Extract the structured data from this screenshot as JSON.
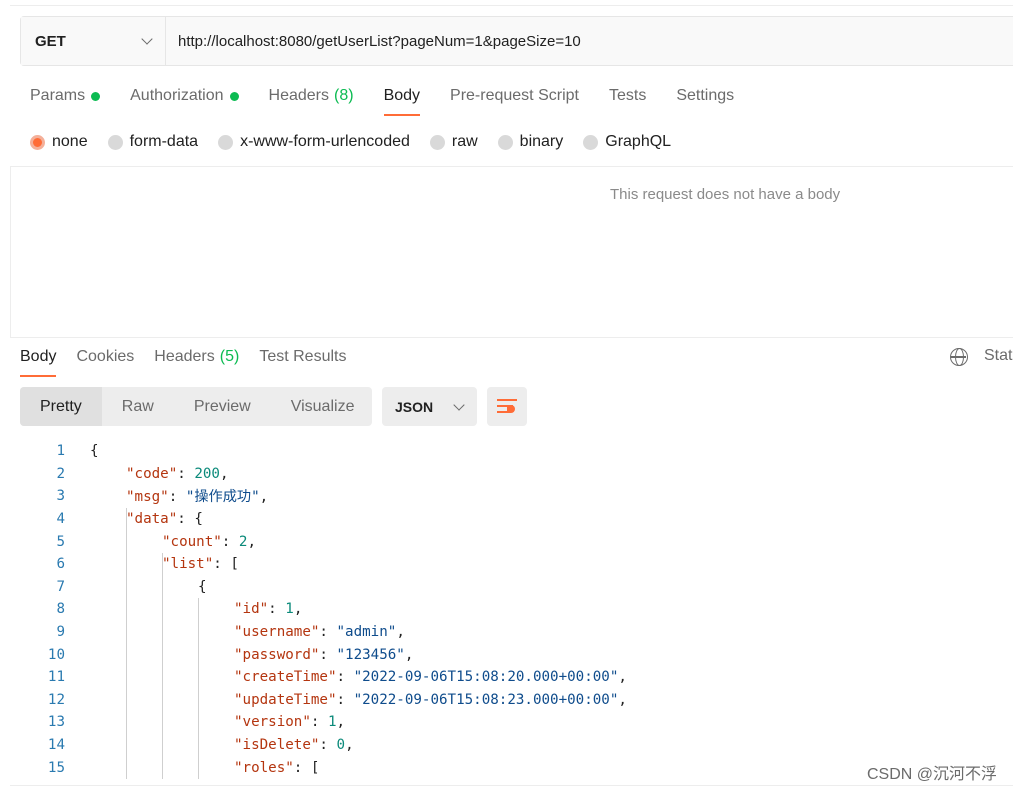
{
  "request": {
    "method": "GET",
    "url": "http://localhost:8080/getUserList?pageNum=1&pageSize=10"
  },
  "request_tabs": [
    {
      "label": "Params"
    },
    {
      "label": "Authorization"
    },
    {
      "label": "Headers",
      "count": "(8)"
    },
    {
      "label": "Body"
    },
    {
      "label": "Pre-request Script"
    },
    {
      "label": "Tests"
    },
    {
      "label": "Settings"
    }
  ],
  "body_types": [
    "none",
    "form-data",
    "x-www-form-urlencoded",
    "raw",
    "binary",
    "GraphQL"
  ],
  "no_body_message": "This request does not have a body",
  "response_tabs": [
    {
      "label": "Body"
    },
    {
      "label": "Cookies"
    },
    {
      "label": "Headers",
      "count": "(5)"
    },
    {
      "label": "Test Results"
    }
  ],
  "status_label": "Status",
  "view_modes": [
    "Pretty",
    "Raw",
    "Preview",
    "Visualize"
  ],
  "format": "JSON",
  "code_lines": [
    {
      "n": "1",
      "text": "{"
    },
    {
      "n": "2",
      "text": "\"code\": 200,"
    },
    {
      "n": "3",
      "text": "\"msg\": \"操作成功\","
    },
    {
      "n": "4",
      "text": "\"data\": {"
    },
    {
      "n": "5",
      "text": "\"count\": 2,"
    },
    {
      "n": "6",
      "text": "\"list\": ["
    },
    {
      "n": "7",
      "text": "{"
    },
    {
      "n": "8",
      "text": "\"id\": 1,"
    },
    {
      "n": "9",
      "text": "\"username\": \"admin\","
    },
    {
      "n": "10",
      "text": "\"password\": \"123456\","
    },
    {
      "n": "11",
      "text": "\"createTime\": \"2022-09-06T15:08:20.000+00:00\","
    },
    {
      "n": "12",
      "text": "\"updateTime\": \"2022-09-06T15:08:23.000+00:00\","
    },
    {
      "n": "13",
      "text": "\"version\": 1,"
    },
    {
      "n": "14",
      "text": "\"isDelete\": 0,"
    },
    {
      "n": "15",
      "text": "\"roles\": ["
    }
  ],
  "watermark": "CSDN @沉河不浮",
  "colors": {
    "accent": "#ff6c37",
    "green": "#0cbb52"
  }
}
